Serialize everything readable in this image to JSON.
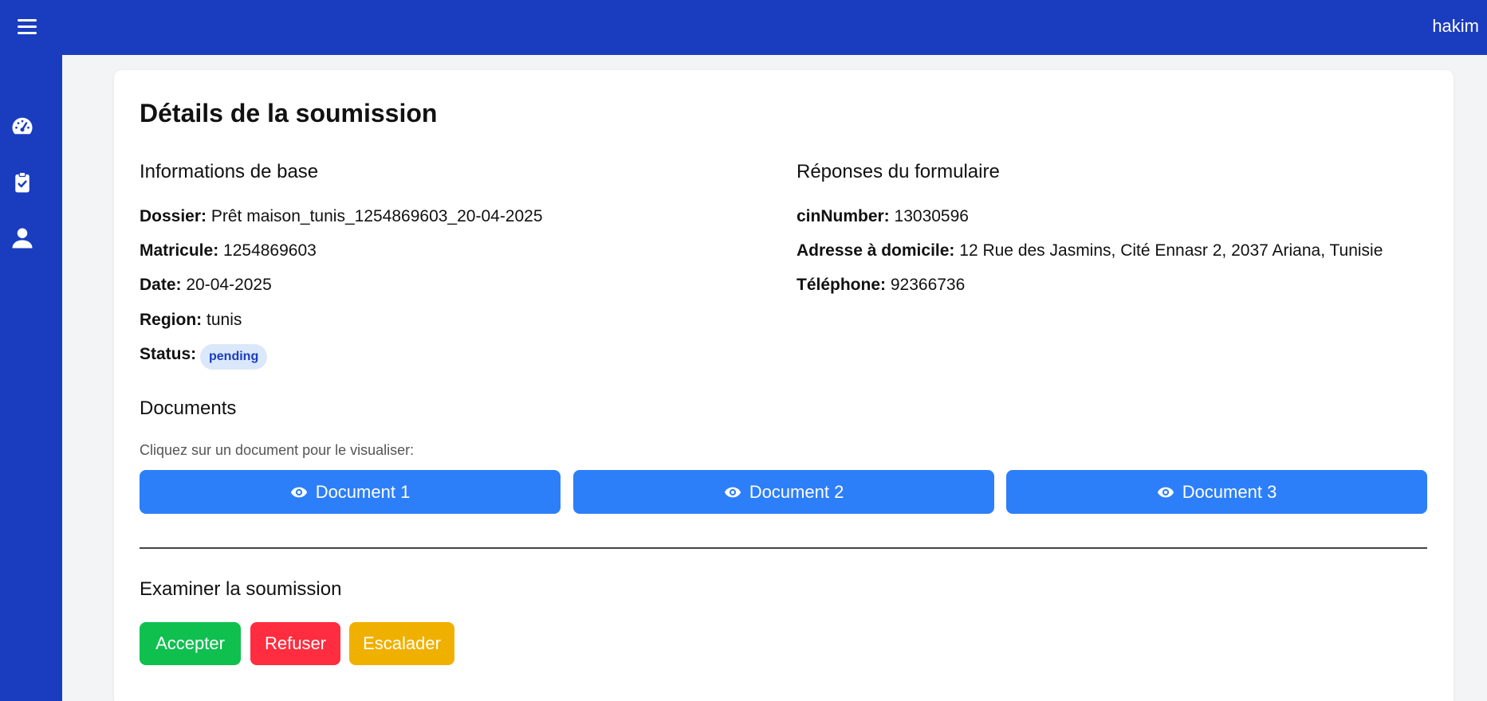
{
  "header": {
    "username": "hakim"
  },
  "sidebar": {
    "items": [
      {
        "icon": "dashboard-gauge-icon"
      },
      {
        "icon": "clipboard-check-icon"
      },
      {
        "icon": "user-icon"
      }
    ]
  },
  "main": {
    "title": "Détails de la soumission",
    "basic_info": {
      "heading": "Informations de base",
      "fields": [
        {
          "label": "Dossier:",
          "value": "Prêt maison_tunis_1254869603_20-04-2025"
        },
        {
          "label": "Matricule:",
          "value": "1254869603"
        },
        {
          "label": "Date:",
          "value": "20-04-2025"
        },
        {
          "label": "Region:",
          "value": "tunis"
        }
      ],
      "status_label": "Status:",
      "status_value": "pending"
    },
    "form_answers": {
      "heading": "Réponses du formulaire",
      "fields": [
        {
          "label": "cinNumber:",
          "value": "13030596"
        },
        {
          "label": "Adresse à domicile:",
          "value": "12 Rue des Jasmins, Cité Ennasr 2, 2037 Ariana, Tunisie"
        },
        {
          "label": "Téléphone:",
          "value": "92366736"
        }
      ]
    },
    "documents": {
      "heading": "Documents",
      "hint": "Cliquez sur un document pour le visualiser:",
      "buttons": [
        "Document 1",
        "Document 2",
        "Document 3"
      ]
    },
    "review": {
      "heading": "Examiner la soumission",
      "accept": "Accepter",
      "reject": "Refuser",
      "escalate": "Escalader"
    }
  },
  "colors": {
    "primary_nav": "#1a3dbf",
    "doc_button": "#2d7ff9",
    "accept": "#0fc04f",
    "reject": "#ff2d3f",
    "escalate": "#f0b000",
    "badge_bg": "#dbe7fb"
  }
}
